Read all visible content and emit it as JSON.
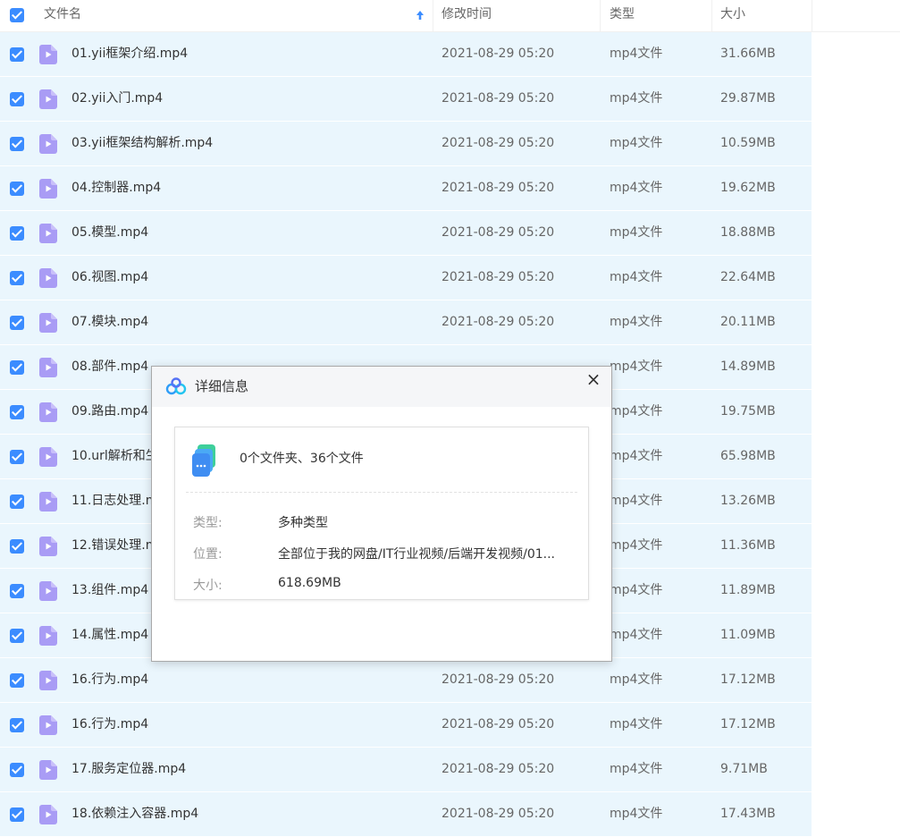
{
  "header": {
    "name": "文件名",
    "date": "修改时间",
    "type": "类型",
    "size": "大小"
  },
  "files": [
    {
      "name": "01.yii框架介绍.mp4",
      "date": "2021-08-29 05:20",
      "type": "mp4文件",
      "size": "31.66MB"
    },
    {
      "name": "02.yii入门.mp4",
      "date": "2021-08-29 05:20",
      "type": "mp4文件",
      "size": "29.87MB"
    },
    {
      "name": "03.yii框架结构解析.mp4",
      "date": "2021-08-29 05:20",
      "type": "mp4文件",
      "size": "10.59MB"
    },
    {
      "name": "04.控制器.mp4",
      "date": "2021-08-29 05:20",
      "type": "mp4文件",
      "size": "19.62MB"
    },
    {
      "name": "05.模型.mp4",
      "date": "2021-08-29 05:20",
      "type": "mp4文件",
      "size": "18.88MB"
    },
    {
      "name": "06.视图.mp4",
      "date": "2021-08-29 05:20",
      "type": "mp4文件",
      "size": "22.64MB"
    },
    {
      "name": "07.模块.mp4",
      "date": "2021-08-29 05:20",
      "type": "mp4文件",
      "size": "20.11MB"
    },
    {
      "name": "08.部件.mp4",
      "date": "",
      "type": "mp4文件",
      "size": "14.89MB"
    },
    {
      "name": "09.路由.mp4",
      "date": "",
      "type": "mp4文件",
      "size": "19.75MB"
    },
    {
      "name": "10.url解析和生",
      "date": "",
      "type": "mp4文件",
      "size": "65.98MB"
    },
    {
      "name": "11.日志处理.m",
      "date": "",
      "type": "mp4文件",
      "size": "13.26MB"
    },
    {
      "name": "12.错误处理.m",
      "date": "",
      "type": "mp4文件",
      "size": "11.36MB"
    },
    {
      "name": "13.组件.mp4",
      "date": "",
      "type": "mp4文件",
      "size": "11.89MB"
    },
    {
      "name": "14.属性.mp4",
      "date": "",
      "type": "mp4文件",
      "size": "11.09MB"
    },
    {
      "name": "16.行为.mp4",
      "date": "2021-08-29 05:20",
      "type": "mp4文件",
      "size": "17.12MB"
    },
    {
      "name": "16.行为.mp4",
      "date": "2021-08-29 05:20",
      "type": "mp4文件",
      "size": "17.12MB"
    },
    {
      "name": "17.服务定位器.mp4",
      "date": "2021-08-29 05:20",
      "type": "mp4文件",
      "size": "9.71MB"
    },
    {
      "name": "18.依赖注入容器.mp4",
      "date": "2021-08-29 05:20",
      "type": "mp4文件",
      "size": "17.43MB"
    }
  ],
  "dialog": {
    "title": "详细信息",
    "close": "×",
    "summary": "0个文件夹、36个文件",
    "type_label": "类型:",
    "type_value": "多种类型",
    "location_label": "位置:",
    "location_value": "全部位于我的网盘/IT行业视频/后端开发视频/01...",
    "size_label": "大小:",
    "size_value": "618.69MB"
  },
  "colors": {
    "accent": "#3b8cff",
    "row_selected": "#eaf6fd",
    "video_icon": "#a99cf5"
  }
}
